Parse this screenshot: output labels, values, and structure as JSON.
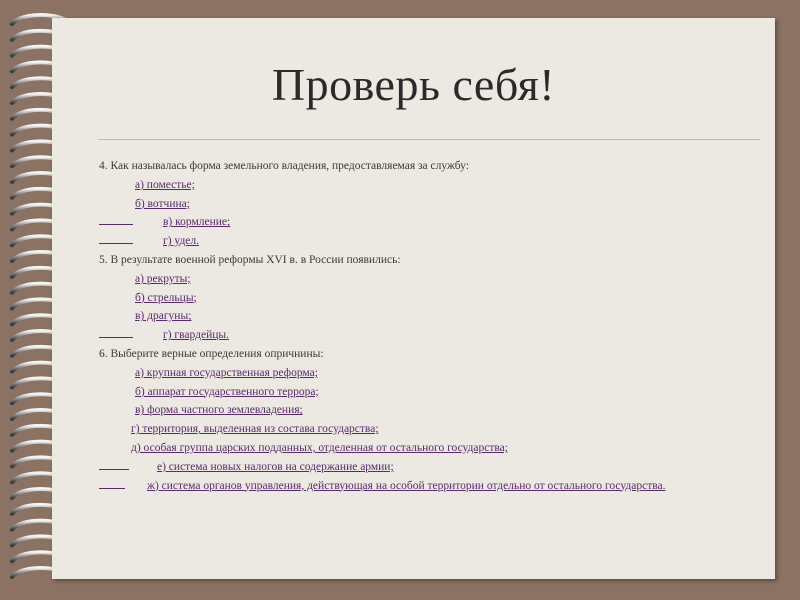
{
  "title": "Проверь себя!",
  "q4": {
    "text": "4. Как называлась форма земельного владения, предоставляемая за службу:",
    "a": "а) поместье;",
    "b": "б) вотчина;",
    "c": "в) кормление;",
    "d": "г) удел."
  },
  "q5": {
    "text": "5. В результате военной реформы  XVI в. в России появились:",
    "a": "а) рекруты;",
    "b": "б) стрельцы;",
    "c": "в) драгуны;",
    "d": "г) гвардейцы."
  },
  "q6": {
    "text": "6. Выберите верные определения опричнины:",
    "a": "а) крупная государственная реформа;",
    "b": "б) аппарат государственного террора;",
    "c": "в) форма частного землевладения;",
    "d": "г) территория, выделенная из состава государства;",
    "e": "д) особая группа царских подданных, отделенная от остального государства;",
    "f": "е) система новых налогов на содержание армии;",
    "g": "ж) система органов управления, действующая на особой территории отдельно от остального государства."
  }
}
